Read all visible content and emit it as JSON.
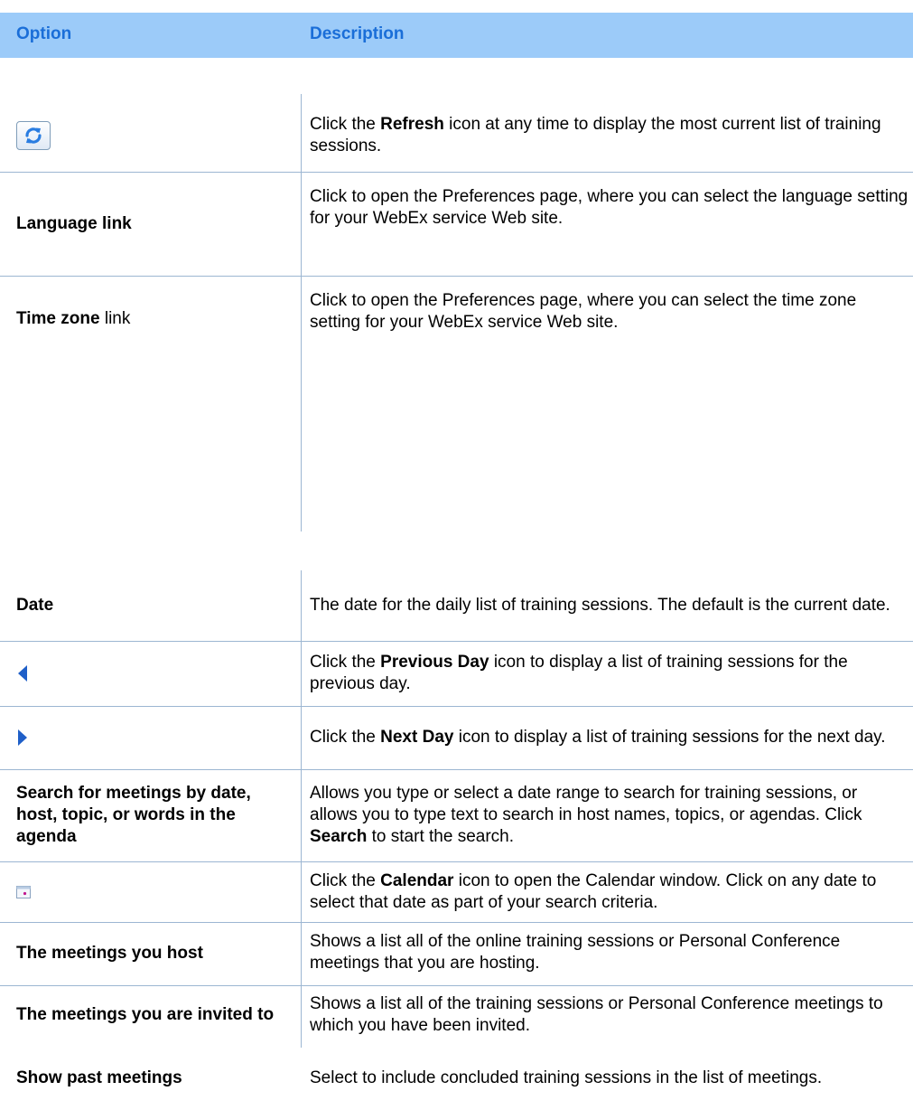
{
  "header": {
    "option_label": "Option",
    "description_label": "Description"
  },
  "rows": [
    {
      "option": "",
      "icon": "refresh-icon",
      "desc": [
        "Click the ",
        "Refresh",
        " icon at any time to display the most current list of training sessions."
      ]
    },
    {
      "option": "Language link",
      "desc": [
        "Click to open the Preferences page, where you can select the language setting for your WebEx service Web site."
      ]
    },
    {
      "option_bold": "Time zone",
      "option_rest": " link",
      "desc": [
        "Click to open the Preferences page, where you can select the time zone setting for your WebEx service Web site."
      ]
    },
    {
      "option": "Date",
      "desc": [
        "The date for the daily list of training sessions. The default is the current date."
      ]
    },
    {
      "option": "",
      "icon": "previous-day-icon",
      "desc": [
        "Click the ",
        "Previous Day",
        " icon to display a list of training sessions for the previous day."
      ]
    },
    {
      "option": "",
      "icon": "next-day-icon",
      "desc": [
        "Click the ",
        "Next Day",
        " icon to display a list of training sessions for the next day."
      ]
    },
    {
      "option": "Search for meetings by date, host, topic, or words in the agenda",
      "desc": [
        "Allows you type or select a date range to search for training sessions, or allows you to type text to search in host names, topics, or agendas. Click ",
        "Search",
        " to start the search."
      ]
    },
    {
      "option": "",
      "icon": "calendar-icon",
      "desc": [
        "Click the ",
        "Calendar",
        " icon to open the Calendar window. Click on any date to select that date as part of your search criteria."
      ]
    },
    {
      "option": "The meetings you host",
      "desc": [
        "Shows a list all of the online training sessions or Personal Conference meetings that you are hosting."
      ]
    },
    {
      "option": "The meetings you are invited to",
      "desc": [
        "Shows a list all of the training sessions or Personal Conference meetings to which you have been invited."
      ]
    },
    {
      "option": "Show past meetings",
      "desc": [
        "Select to include concluded training sessions in the list of meetings."
      ]
    }
  ]
}
